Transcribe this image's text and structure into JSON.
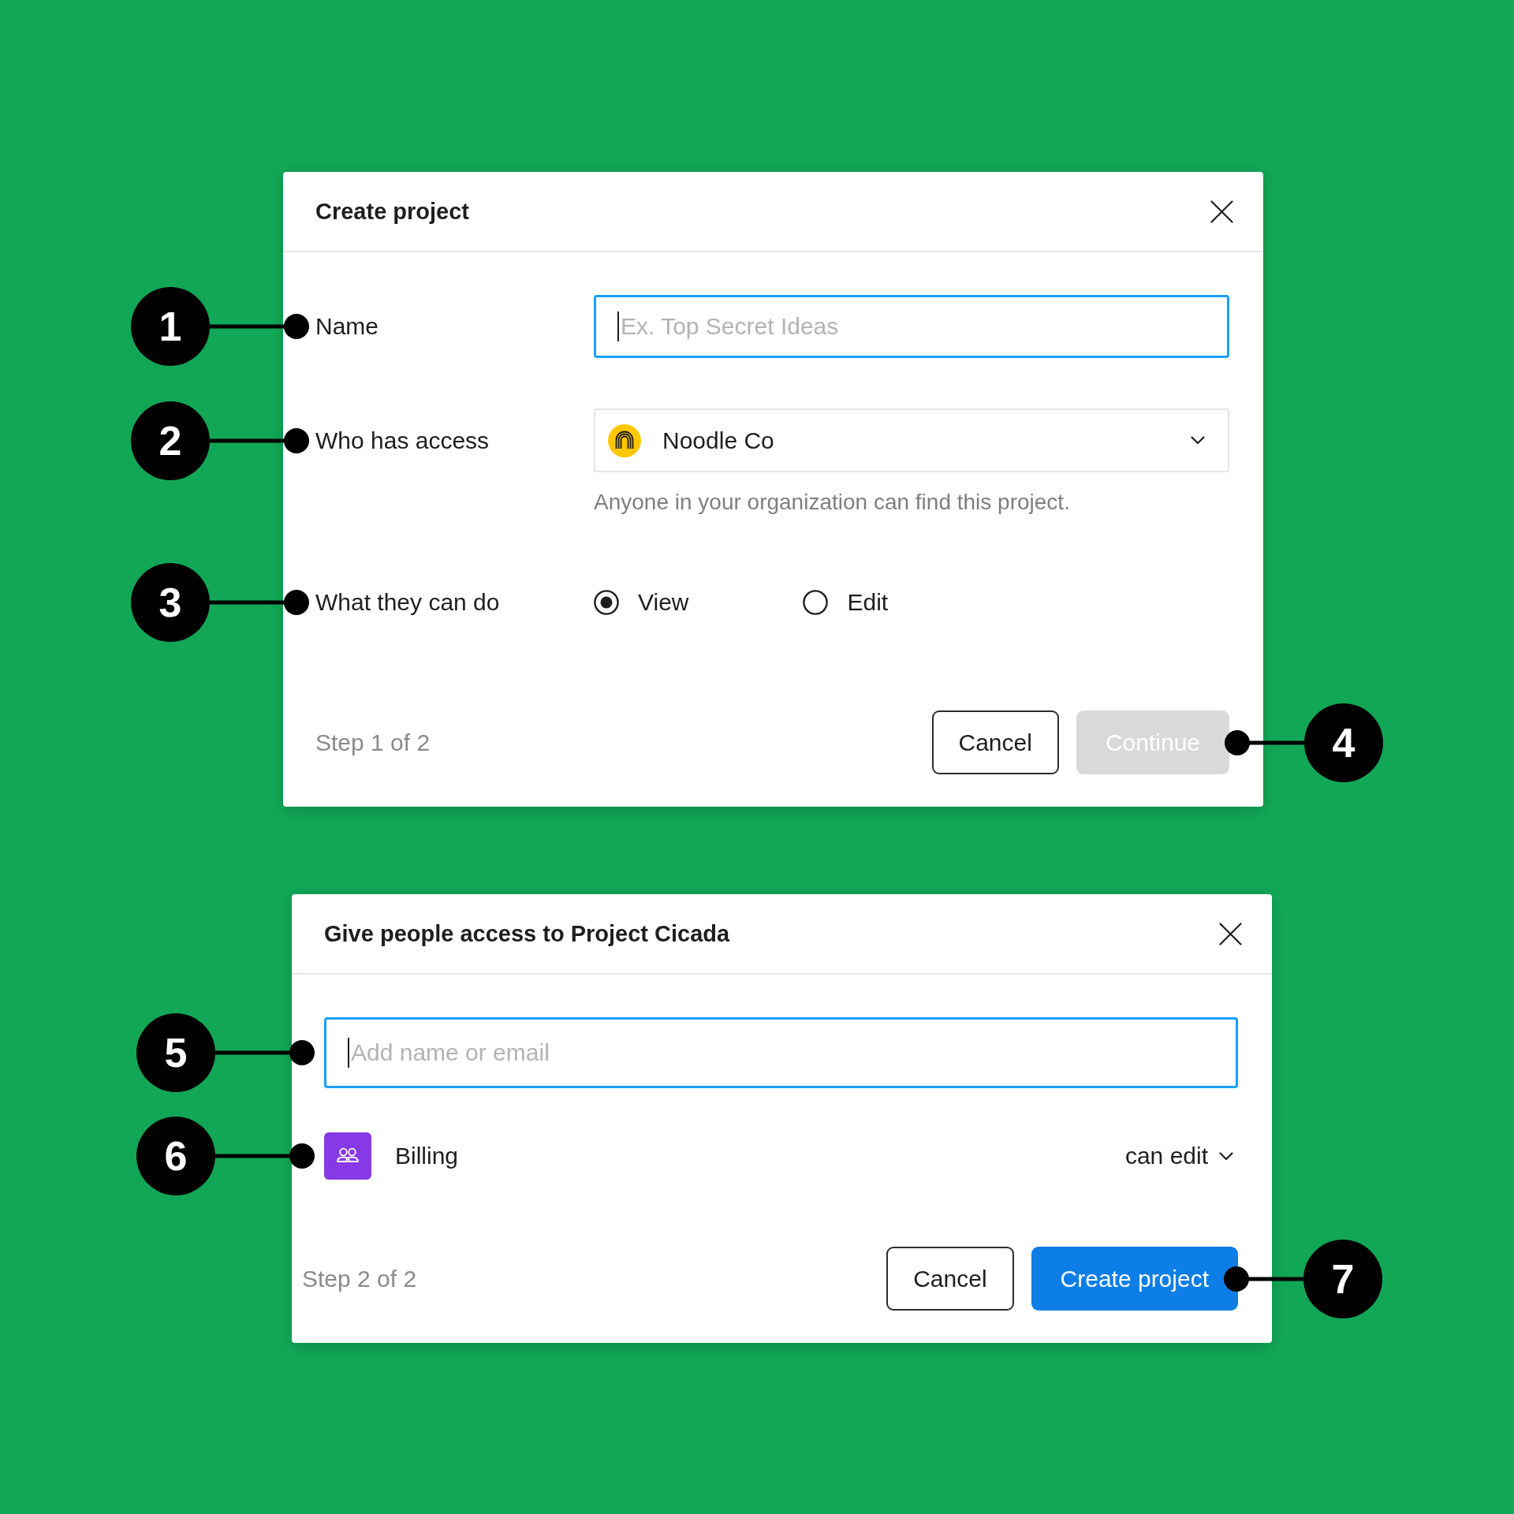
{
  "dialogs": [
    {
      "title": "Create project",
      "rows": [
        {
          "kind": "text",
          "label": "Name",
          "placeholder": "Ex. Top Secret Ideas",
          "focused": true,
          "callout": "1"
        },
        {
          "kind": "select",
          "label": "Who has access",
          "value": "Noodle Co",
          "hint": "Anyone in your organization can find this project.",
          "callout": "2"
        },
        {
          "kind": "radio",
          "label": "What they can do",
          "options": [
            {
              "label": "View",
              "selected": true
            },
            {
              "label": "Edit",
              "selected": false
            }
          ],
          "callout": "3"
        }
      ],
      "footer": {
        "step": "Step 1 of 2",
        "buttons": [
          {
            "label": "Cancel",
            "kind": "secondary",
            "disabled": false
          },
          {
            "label": "Continue",
            "kind": "primary",
            "disabled": true,
            "callout": "4"
          }
        ]
      }
    },
    {
      "title": "Give people access to Project Cicada",
      "rows": [
        {
          "kind": "text",
          "placeholder": "Add name or email",
          "focused": true,
          "callout": "5"
        },
        {
          "kind": "member",
          "name": "Billing",
          "permission": "can edit",
          "callout": "6"
        }
      ],
      "footer": {
        "step": "Step 2 of 2",
        "buttons": [
          {
            "label": "Cancel",
            "kind": "secondary",
            "disabled": false
          },
          {
            "label": "Create project",
            "kind": "primary",
            "disabled": false,
            "callout": "7"
          }
        ]
      }
    }
  ]
}
